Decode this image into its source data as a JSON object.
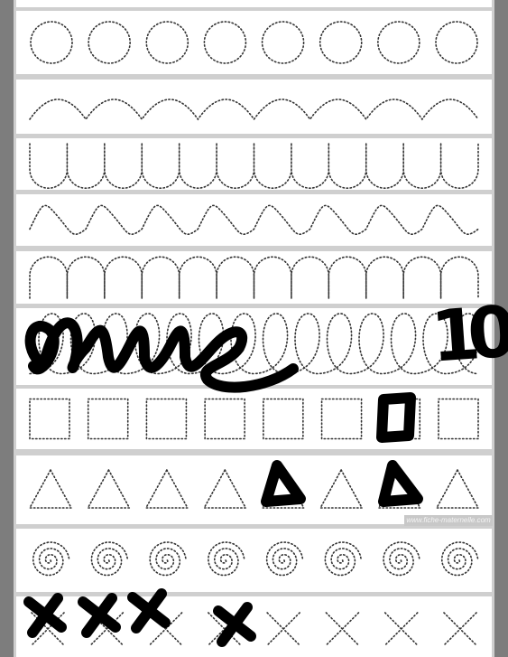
{
  "worksheet": {
    "rows": [
      {
        "pattern": "circles",
        "count": 8
      },
      {
        "pattern": "arcs",
        "count": 8
      },
      {
        "pattern": "u-cups",
        "count": 12
      },
      {
        "pattern": "waves",
        "count": 8
      },
      {
        "pattern": "arches",
        "count": 12
      },
      {
        "pattern": "loops",
        "count": 14
      },
      {
        "pattern": "squares",
        "count": 8
      },
      {
        "pattern": "triangles",
        "count": 8
      },
      {
        "pattern": "spirals",
        "count": 8
      },
      {
        "pattern": "crosses",
        "count": 8
      }
    ],
    "watermark": "www.fiche-maternelle.com",
    "handwritten_score": "10"
  },
  "colors": {
    "page_bg": "#7d7d7d",
    "row_sep": "#cfcfcf",
    "dots": "#333333",
    "marker": "#000000"
  }
}
